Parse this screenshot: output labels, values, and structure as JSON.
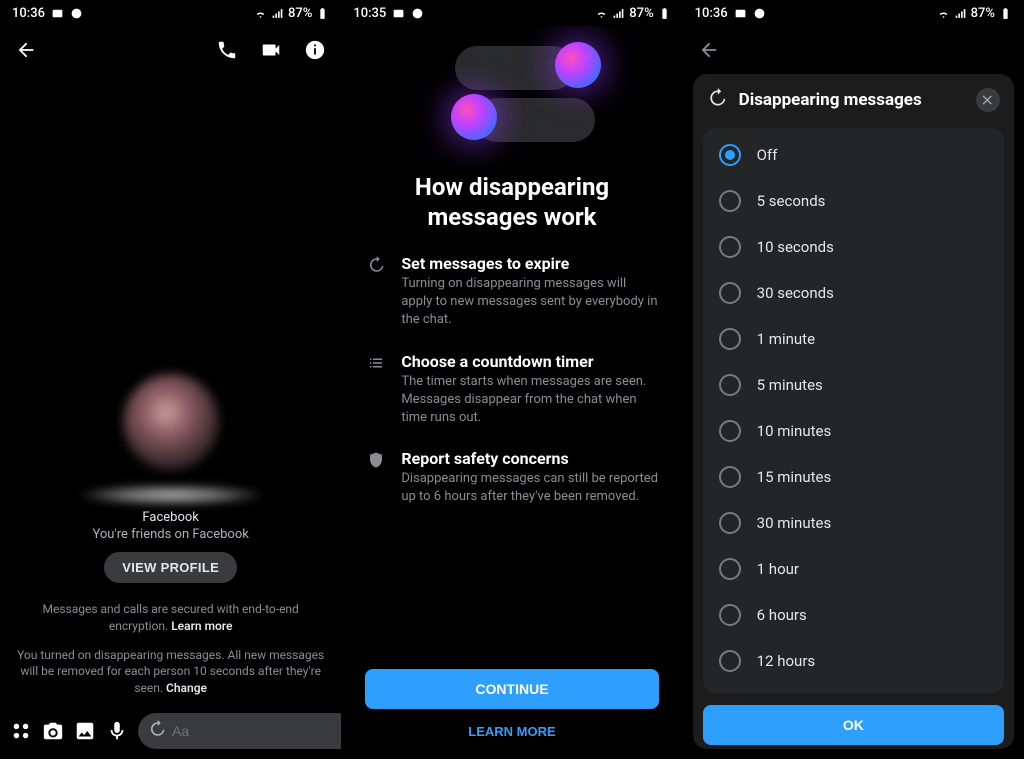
{
  "status": {
    "time_a": "10:36",
    "time_b": "10:35",
    "time_c": "10:36",
    "battery": "87%"
  },
  "screen1": {
    "platform": "Facebook",
    "friends_line": "You're friends on Facebook",
    "view_profile": "VIEW PROFILE",
    "e2e_prefix": "Messages and calls are secured with end-to-end encryption. ",
    "e2e_link": "Learn more",
    "dm_notice_prefix": "You turned on disappearing messages. All new messages will be removed for each person 10 seconds after they're seen. ",
    "dm_notice_link": "Change",
    "compose_placeholder": "Aa"
  },
  "screen2": {
    "title": "How disappearing messages work",
    "features": [
      {
        "heading": "Set messages to expire",
        "body": "Turning on disappearing messages will apply to new messages sent by everybody in the chat."
      },
      {
        "heading": "Choose a countdown timer",
        "body": "The timer starts when messages are seen. Messages disappear from the chat when time runs out."
      },
      {
        "heading": "Report safety concerns",
        "body": "Disappearing messages can still be reported up to 6 hours after they've been removed."
      }
    ],
    "continue": "CONTINUE",
    "learn_more": "LEARN MORE"
  },
  "screen3": {
    "title": "Disappearing messages",
    "options": [
      "Off",
      "5 seconds",
      "10 seconds",
      "30 seconds",
      "1 minute",
      "5 minutes",
      "10 minutes",
      "15 minutes",
      "30 minutes",
      "1 hour",
      "6 hours",
      "12 hours"
    ],
    "selected_index": 0,
    "ok": "OK"
  }
}
